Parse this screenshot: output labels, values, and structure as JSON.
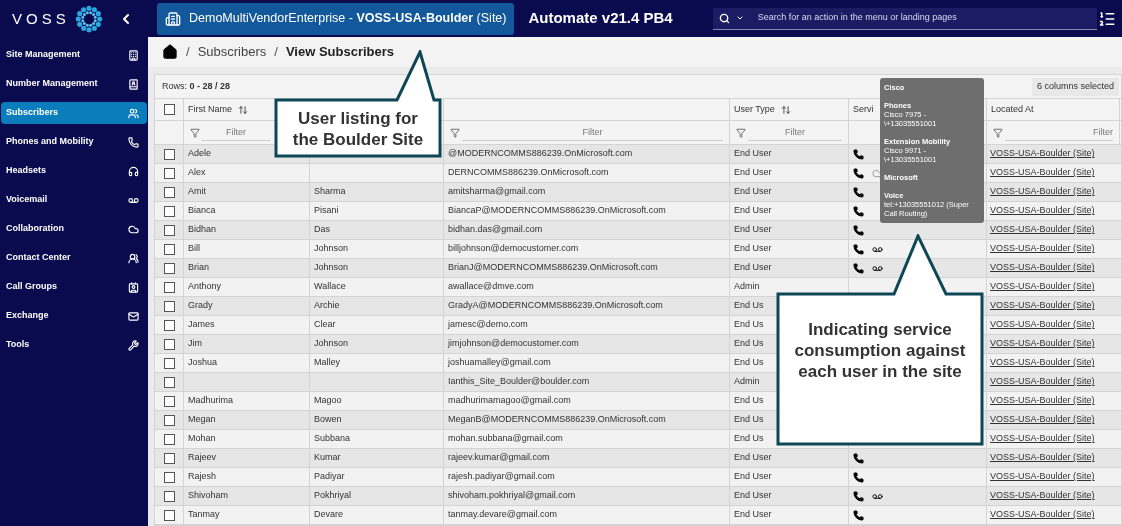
{
  "app": {
    "logo": "VOSS",
    "site_button": "DemoMultiVendorEnterprise -  **VOSS-USA-Boulder** (Site)",
    "title": "Automate v21.4 PB4",
    "search": {
      "placeholder": "Search for an action in the menu or landing pages"
    }
  },
  "sidebar": {
    "items": [
      {
        "label": "Site Management",
        "selected": false
      },
      {
        "label": "Number Management",
        "selected": false
      },
      {
        "label": "Subscribers",
        "selected": true
      },
      {
        "label": "Phones and Mobility",
        "selected": false
      },
      {
        "label": "Headsets",
        "selected": false
      },
      {
        "label": "Voicemail",
        "selected": false
      },
      {
        "label": "Collaboration",
        "selected": false
      },
      {
        "label": "Contact Center",
        "selected": false
      },
      {
        "label": "Call Groups",
        "selected": false
      },
      {
        "label": "Exchange",
        "selected": false
      },
      {
        "label": "Tools",
        "selected": false
      }
    ]
  },
  "breadcrumb": [
    {
      "separator": "/",
      "label": "Subscribers"
    },
    {
      "separator": "/",
      "label": "View Subscribers"
    }
  ],
  "table": {
    "rows_label": "Rows:",
    "rows_count": "0 - 28 / 28",
    "columns_button": "6 columns selected",
    "select_all_checked": false,
    "columns": [
      {
        "label": "First Name",
        "sortable": true,
        "placeholder": "Filter"
      },
      {},
      {
        "placeholder": "Filter"
      },
      {
        "label": "User Type",
        "sortable": true,
        "placeholder": "Filter"
      },
      {
        "label": "Servi"
      },
      {
        "label": "Located At",
        "placeholder": "Filter"
      }
    ],
    "rows": [
      {
        "checked": false,
        "first": "Adele",
        "email": "@MODERNCOMMS886239.OnMicrosoft.com",
        "user_type": "End User",
        "services": [
          {
            "kind": "phone"
          }
        ],
        "location": "VOSS-USA-Boulder (Site)"
      },
      {
        "checked": false,
        "first": "Alex",
        "email": "DERNCOMMS886239.OnMicrosoft.com",
        "user_type": "End User",
        "services": [
          {
            "kind": "phone"
          },
          {
            "kind": "cloud"
          }
        ],
        "location": "VOSS-USA-Boulder (Site)"
      },
      {
        "checked": false,
        "first": "Amit",
        "last": "Sharma",
        "email": "amitsharma@gmail.com",
        "user_type": "End User",
        "services": [
          {
            "kind": "phone"
          }
        ],
        "location": "VOSS-USA-Boulder (Site)"
      },
      {
        "checked": false,
        "first": "Bianca",
        "last": "Pisani",
        "email": "BiancaP@MODERNCOMMS886239.OnMicrosoft.com",
        "user_type": "End User",
        "services": [
          {
            "kind": "phone"
          }
        ],
        "location": "VOSS-USA-Boulder (Site)"
      },
      {
        "checked": false,
        "first": "Bidhan",
        "last": "Das",
        "email": "bidhan.das@gmail.com",
        "user_type": "End User",
        "services": [
          {
            "kind": "phone"
          }
        ],
        "location": "VOSS-USA-Boulder (Site)"
      },
      {
        "checked": false,
        "first": "Bill",
        "last": "Johnson",
        "email": "billjohnson@democustomer.com",
        "user_type": "End User",
        "services": [
          {
            "kind": "phone"
          },
          {
            "kind": "voicemail"
          }
        ],
        "location": "VOSS-USA-Boulder (Site)"
      },
      {
        "checked": false,
        "first": "Brian",
        "last": "Johnson",
        "email": "BrianJ@MODERNCOMMS886239.OnMicrosoft.com",
        "user_type": "End User",
        "services": [
          {
            "kind": "phone"
          },
          {
            "kind": "voicemail"
          }
        ],
        "location": "VOSS-USA-Boulder (Site)"
      },
      {
        "checked": false,
        "first": "Anthony",
        "last": "Wallace",
        "email": "awallace@dmve.com",
        "user_type": "Admin",
        "services": [],
        "location": "VOSS-USA-Boulder (Site)"
      },
      {
        "checked": false,
        "first": "Grady",
        "last": "Archie",
        "email": "GradyA@MODERNCOMMS886239.OnMicrosoft.com",
        "user_type": "End Us",
        "services": [],
        "location": "VOSS-USA-Boulder (Site)"
      },
      {
        "checked": false,
        "first": "James",
        "last": "Clear",
        "email": "jamesc@demo.com",
        "user_type": "End Us",
        "services": [],
        "location": "VOSS-USA-Boulder (Site)"
      },
      {
        "checked": false,
        "first": "Jim",
        "last": "Johnson",
        "email": "jimjohnson@democustomer.com",
        "user_type": "End Us",
        "services": [],
        "location": "VOSS-USA-Boulder (Site)"
      },
      {
        "checked": false,
        "first": "Joshua",
        "last": "Malley",
        "email": "joshuamalley@gmail.com",
        "user_type": "End Us",
        "services": [],
        "location": "VOSS-USA-Boulder (Site)"
      },
      {
        "checked": false,
        "email": "Ianthis_Site_Boulder@boulder.com",
        "user_type": "Admin",
        "services": [],
        "location": "VOSS-USA-Boulder (Site)"
      },
      {
        "checked": false,
        "first": "Madhurima",
        "last": "Magoo",
        "email": "madhurimamagoo@gmail.com",
        "user_type": "End Us",
        "services": [],
        "location": "VOSS-USA-Boulder (Site)"
      },
      {
        "checked": false,
        "first": "Megan",
        "last": "Bowen",
        "email": "MeganB@MODERNCOMMS886239.OnMicrosoft.com",
        "user_type": "End Us",
        "services": [],
        "location": "VOSS-USA-Boulder (Site)"
      },
      {
        "checked": false,
        "first": "Mohan",
        "last": "Subbana",
        "email": "mohan.subbana@gmail.com",
        "user_type": "End Us",
        "services": [],
        "location": "VOSS-USA-Boulder (Site)"
      },
      {
        "checked": false,
        "first": "Rajeev",
        "last": "Kumar",
        "email": "rajeev.kumar@gmail.com",
        "user_type": "End User",
        "services": [
          {
            "kind": "phone"
          }
        ],
        "location": "VOSS-USA-Boulder (Site)"
      },
      {
        "checked": false,
        "first": "Rajesh",
        "last": "Padiyar",
        "email": "rajesh.padiyar@gmail.com",
        "user_type": "End User",
        "services": [
          {
            "kind": "phone"
          }
        ],
        "location": "VOSS-USA-Boulder (Site)"
      },
      {
        "checked": false,
        "first": "Shivoham",
        "last": "Pokhriyal",
        "email": "shivoham.pokhriyal@gmail.com",
        "user_type": "End User",
        "services": [
          {
            "kind": "phone"
          },
          {
            "kind": "voicemail"
          }
        ],
        "location": "VOSS-USA-Boulder (Site)"
      },
      {
        "checked": false,
        "first": "Tanmay",
        "last": "Devare",
        "email": "tanmay.devare@gmail.com",
        "user_type": "End User",
        "services": [
          {
            "kind": "phone"
          }
        ],
        "location": "VOSS-USA-Boulder (Site)"
      }
    ]
  },
  "tooltip": {
    "groups": [
      {
        "vendor": "Cisco",
        "items": [
          {
            "label": "Phones",
            "value": "Cisco 7975 - \\+13035551001"
          },
          {
            "label": "Extension Mobility",
            "value": "Cisco 9971 - \\+13035551001"
          }
        ]
      },
      {
        "vendor": "Microsoft",
        "items": [
          {
            "label": "Voice",
            "value": "tel:+13035551012 (Super Call Routing)"
          }
        ]
      }
    ]
  },
  "callouts": [
    "User listing for the Boulder Site",
    "Indicating service consumption against each user in the site"
  ]
}
